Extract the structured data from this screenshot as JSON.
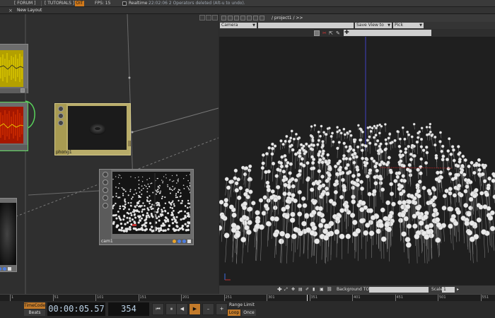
{
  "topbar": {
    "forum": "[ FORUM ]",
    "tutorials": "[ TUTORIALS ]",
    "oit": "OIT",
    "fps": "FPS:  15",
    "realtime": "Realtime",
    "status": "22:02:06 2 Operators deleted (Alt-u to undo)."
  },
  "tabs": {
    "close": "×",
    "layout": "New Layout"
  },
  "nodes": {
    "phong": {
      "name": "phong1"
    },
    "cam": {
      "name": "cam1"
    }
  },
  "viewer": {
    "path": "/ project1 / >>",
    "camera_select": "Camera",
    "save_view": "Save View to",
    "pick": "Pick",
    "background_top_label": "Background TOP:",
    "scale_label": "Scale:",
    "scale_value": "1"
  },
  "timeline": {
    "ticks": [
      "1",
      "51",
      "101",
      "151",
      "201",
      "251",
      "301",
      "351",
      "401",
      "451",
      "501",
      "551"
    ],
    "timecode_label": "TimeCode",
    "beats_label": "Beats",
    "timecode": "00:00:05.57",
    "frame": "354",
    "range_limit": "Range Limit",
    "loop": "Loop",
    "once": "Once"
  },
  "colors": {
    "accent": "#d27a1b",
    "node_body": "#6d6d6d",
    "phong_tint": "#b9ad6a",
    "yellow_preview": "#c8b400",
    "red_preview": "#c81e00",
    "selection_green": "#59d35b"
  }
}
